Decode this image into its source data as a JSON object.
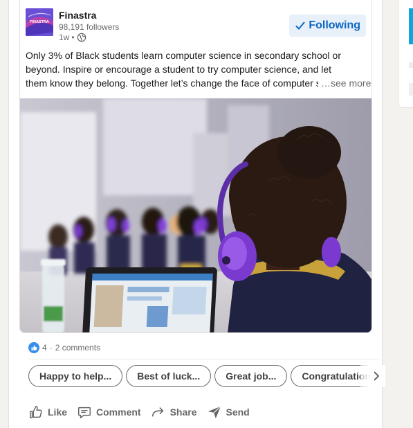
{
  "post": {
    "author": {
      "name": "Finastra",
      "followers": "98,191 followers",
      "time": "1w",
      "logo_text": "FINASTRA"
    },
    "follow_button": {
      "icon": "checkmark-icon",
      "label": "Following"
    },
    "text": {
      "line1": "Only 3% of Black students learn computer science in secondary school or",
      "line2": "beyond. Inspire or encourage a student to try computer science, and let",
      "line3": "them know they belong. Together let’s change the face of computer science.",
      "see_more": "…see more"
    },
    "image": {},
    "social": {
      "reactions": "4",
      "separator": "·",
      "comments": "2 comments"
    },
    "suggested_replies": [
      "Happy to help...",
      "Best of luck...",
      "Great job...",
      "Congratulations..."
    ],
    "actions": {
      "like": "Like",
      "comment": "Comment",
      "share": "Share",
      "send": "Send"
    }
  },
  "colors": {
    "brand_link": "#0a66c2",
    "follow_bg": "#e8f0fa",
    "finastra_purple": "#694ed6",
    "headphone_purple": "#7a3ad0"
  }
}
